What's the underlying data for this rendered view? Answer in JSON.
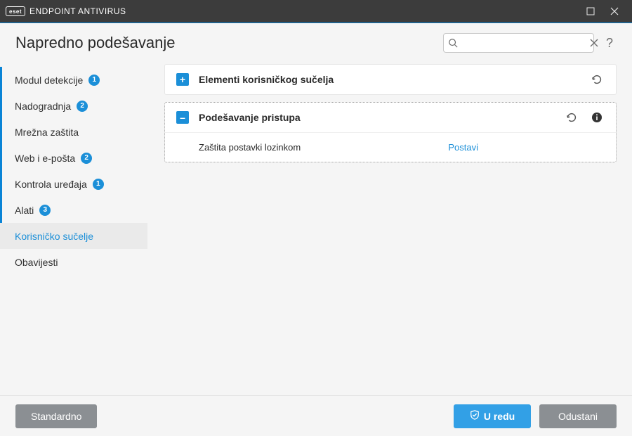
{
  "titlebar": {
    "brand_badge": "eset",
    "brand_text": "ENDPOINT ANTIVIRUS"
  },
  "header": {
    "title": "Napredno podešavanje",
    "search_placeholder": ""
  },
  "sidebar": {
    "items": [
      {
        "label": "Modul detekcije",
        "badge": "1"
      },
      {
        "label": "Nadogradnja",
        "badge": "2"
      },
      {
        "label": "Mrežna zaštita",
        "badge": ""
      },
      {
        "label": "Web i e-pošta",
        "badge": "2"
      },
      {
        "label": "Kontrola uređaja",
        "badge": "1"
      },
      {
        "label": "Alati",
        "badge": "3"
      },
      {
        "label": "Korisničko sučelje",
        "badge": ""
      },
      {
        "label": "Obavijesti",
        "badge": ""
      }
    ]
  },
  "panels": {
    "ui_elements": {
      "title": "Elementi korisničkog sučelja"
    },
    "access": {
      "title": "Podešavanje pristupa",
      "password_protect_label": "Zaštita postavki lozinkom",
      "set_link": "Postavi"
    }
  },
  "footer": {
    "default_btn": "Standardno",
    "ok_btn": "U redu",
    "cancel_btn": "Odustani"
  }
}
